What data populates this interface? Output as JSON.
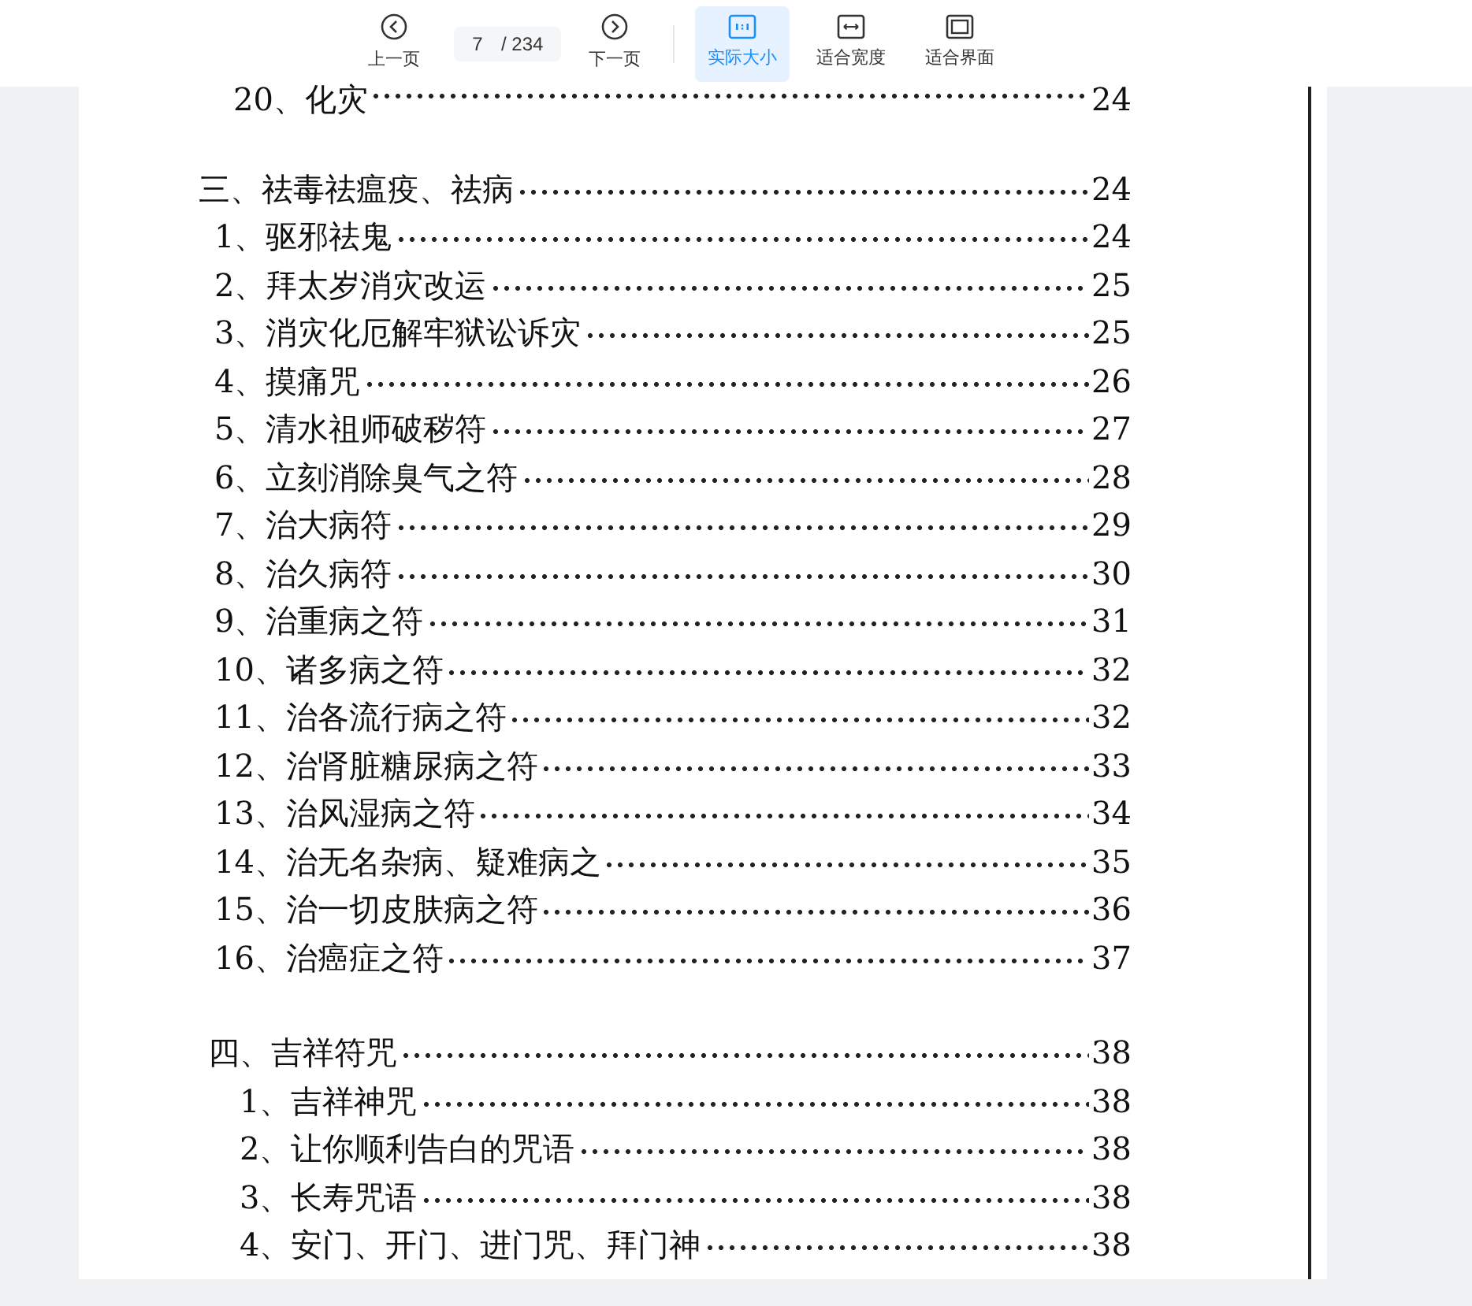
{
  "toolbar": {
    "buttons": [
      {
        "kind": "prev",
        "label": "上一页",
        "selected": false
      },
      {
        "kind": "page",
        "value": "7",
        "total": "/ 234"
      },
      {
        "kind": "next",
        "label": "下一页",
        "selected": false
      },
      {
        "kind": "actual",
        "label": "实际大小",
        "selected": true
      },
      {
        "kind": "width",
        "label": "适合宽度",
        "selected": false
      },
      {
        "kind": "fit",
        "label": "适合界面",
        "selected": false
      }
    ]
  },
  "document": {
    "toc": [
      {
        "children": [
          {
            "title": "20、化灾",
            "page": "24"
          }
        ]
      },
      {
        "title": "三、祛毒祛瘟疫、祛病",
        "page": "24",
        "children": [
          {
            "title": "1、驱邪祛鬼",
            "page": "24"
          },
          {
            "title": "2、拜太岁消灾改运",
            "page": "25"
          },
          {
            "title": "3、消灾化厄解牢狱讼诉灾",
            "page": "25"
          },
          {
            "title": "4、摸痛咒",
            "page": "26"
          },
          {
            "title": "5、清水祖师破秽符",
            "page": "27"
          },
          {
            "title": "6、立刻消除臭气之符",
            "page": "28"
          },
          {
            "title": "7、治大病符",
            "page": "29"
          },
          {
            "title": "8、治久病符",
            "page": "30"
          },
          {
            "title": "9、治重病之符",
            "page": "31"
          },
          {
            "title": "10、诸多病之符",
            "page": "32"
          },
          {
            "title": "11、治各流行病之符",
            "page": "32"
          },
          {
            "title": "12、治肾脏糖尿病之符",
            "page": "33"
          },
          {
            "title": "13、治风湿病之符",
            "page": "34"
          },
          {
            "title": "14、治无名杂病、疑难病之",
            "page": "35"
          },
          {
            "title": "15、治一切皮肤病之符",
            "page": "36"
          },
          {
            "title": "16、治癌症之符",
            "page": "37"
          }
        ]
      },
      {
        "title": "四、吉祥符咒",
        "page": "38",
        "children": [
          {
            "title": "1、吉祥神咒",
            "page": "38"
          },
          {
            "title": "2、让你顺利告白的咒语",
            "page": "38"
          },
          {
            "title": "3、长寿咒语",
            "page": "38"
          },
          {
            "title": "4、安门、开门、进门咒、拜门神",
            "page": "38"
          }
        ]
      }
    ]
  }
}
